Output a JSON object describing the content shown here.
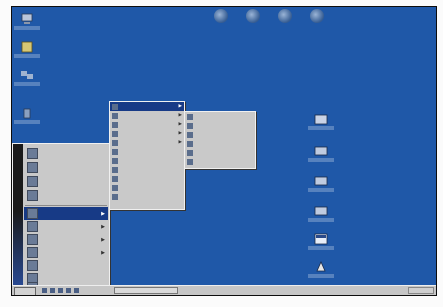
{
  "desktop": {
    "background": "#1f58a8",
    "left_icons": [
      "computer-icon",
      "documents-icon",
      "network-icon",
      "recycle-icon"
    ],
    "top_icons": [
      "app-icon-1",
      "app-icon-2",
      "app-icon-3",
      "app-icon-4"
    ],
    "right_icons": [
      "shortcut-icon-1",
      "shortcut-icon-2",
      "shortcut-icon-3",
      "shortcut-icon-4",
      "shortcut-icon-5",
      "shortcut-icon-6"
    ]
  },
  "start_menu": {
    "sidebar_text": "",
    "pinned": [
      {
        "label": "",
        "icon": "folder-icon"
      },
      {
        "label": "",
        "icon": "app-icon"
      },
      {
        "label": "",
        "icon": "app-icon"
      },
      {
        "label": "",
        "icon": "app-icon"
      }
    ],
    "items": [
      {
        "label": "",
        "icon": "programs-icon",
        "submenu": true,
        "selected": true
      },
      {
        "label": "",
        "icon": "documents-icon",
        "submenu": true
      },
      {
        "label": "",
        "icon": "settings-icon",
        "submenu": true
      },
      {
        "label": "",
        "icon": "search-icon",
        "submenu": true
      },
      {
        "label": "",
        "icon": "help-icon",
        "submenu": false
      },
      {
        "label": "",
        "icon": "run-icon",
        "submenu": false
      },
      {
        "label": "",
        "icon": "shutdown-icon",
        "submenu": false
      }
    ]
  },
  "submenu1": {
    "items": [
      {
        "label": "",
        "submenu": true,
        "selected": true
      },
      {
        "label": "",
        "submenu": true
      },
      {
        "label": "",
        "submenu": true
      },
      {
        "label": "",
        "submenu": true
      },
      {
        "label": "",
        "submenu": true
      },
      {
        "label": "",
        "submenu": false
      },
      {
        "label": "",
        "submenu": false
      },
      {
        "label": "",
        "submenu": false
      },
      {
        "label": "",
        "submenu": false
      },
      {
        "label": "",
        "submenu": false
      },
      {
        "label": "",
        "submenu": false
      }
    ]
  },
  "submenu2": {
    "items": [
      {
        "label": ""
      },
      {
        "label": ""
      },
      {
        "label": ""
      },
      {
        "label": ""
      },
      {
        "label": ""
      },
      {
        "label": ""
      }
    ]
  },
  "taskbar": {
    "start_label": "",
    "task_label": "",
    "clock": ""
  }
}
